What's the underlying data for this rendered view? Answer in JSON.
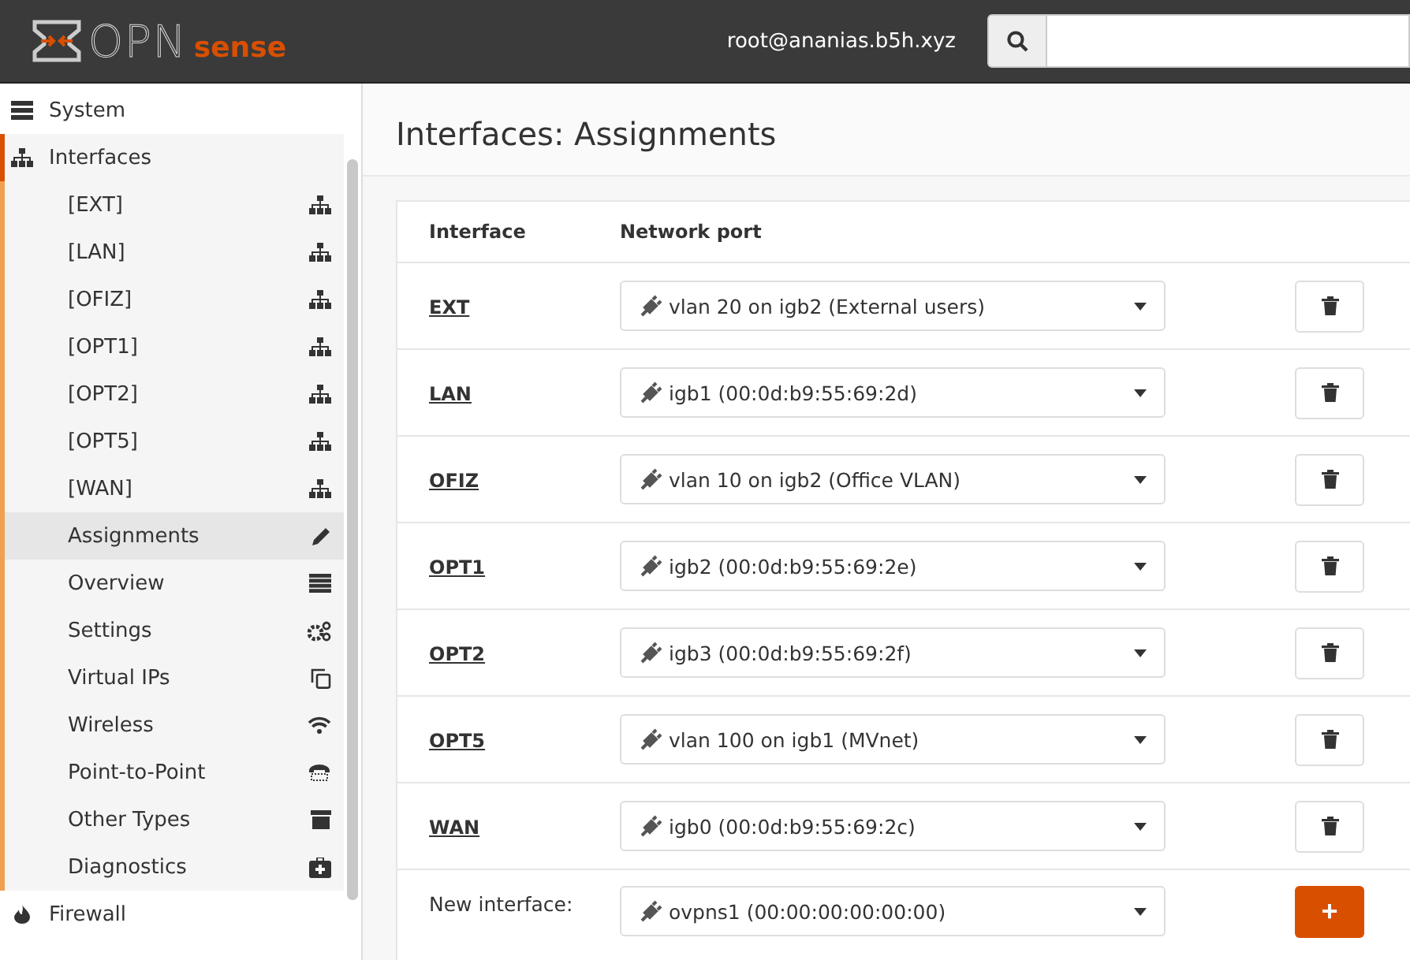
{
  "header": {
    "logo_main": "OPN",
    "logo_accent": "sense",
    "user": "root@ananias.b5h.xyz"
  },
  "sidebar": {
    "items": [
      {
        "label": "System",
        "expanded": false
      },
      {
        "label": "Interfaces",
        "expanded": true,
        "children": [
          {
            "label": "[EXT]",
            "selected": false
          },
          {
            "label": "[LAN]",
            "selected": false
          },
          {
            "label": "[OFIZ]",
            "selected": false
          },
          {
            "label": "[OPT1]",
            "selected": false
          },
          {
            "label": "[OPT2]",
            "selected": false
          },
          {
            "label": "[OPT5]",
            "selected": false
          },
          {
            "label": "[WAN]",
            "selected": false
          },
          {
            "label": "Assignments",
            "selected": true
          },
          {
            "label": "Overview",
            "selected": false
          },
          {
            "label": "Settings",
            "selected": false
          },
          {
            "label": "Virtual IPs",
            "selected": false
          },
          {
            "label": "Wireless",
            "selected": false
          },
          {
            "label": "Point-to-Point",
            "selected": false
          },
          {
            "label": "Other Types",
            "selected": false
          },
          {
            "label": "Diagnostics",
            "selected": false
          }
        ]
      },
      {
        "label": "Firewall",
        "expanded": false
      }
    ]
  },
  "page": {
    "title": "Interfaces: Assignments"
  },
  "table": {
    "columns": [
      "Interface",
      "Network port"
    ],
    "rows": [
      {
        "interface": "EXT",
        "port": "vlan 20 on igb2 (External users)"
      },
      {
        "interface": "LAN",
        "port": "igb1 (00:0d:b9:55:69:2d)"
      },
      {
        "interface": "OFIZ",
        "port": "vlan 10 on igb2 (Office VLAN)"
      },
      {
        "interface": "OPT1",
        "port": "igb2 (00:0d:b9:55:69:2e)"
      },
      {
        "interface": "OPT2",
        "port": "igb3 (00:0d:b9:55:69:2f)"
      },
      {
        "interface": "OPT5",
        "port": "vlan 100 on igb1 (MVnet)"
      },
      {
        "interface": "WAN",
        "port": "igb0 (00:0d:b9:55:69:2c)"
      }
    ],
    "new_interface": {
      "label": "New interface:",
      "port": "ovpns1 (00:00:00:00:00:00)",
      "add_button": "+"
    }
  }
}
